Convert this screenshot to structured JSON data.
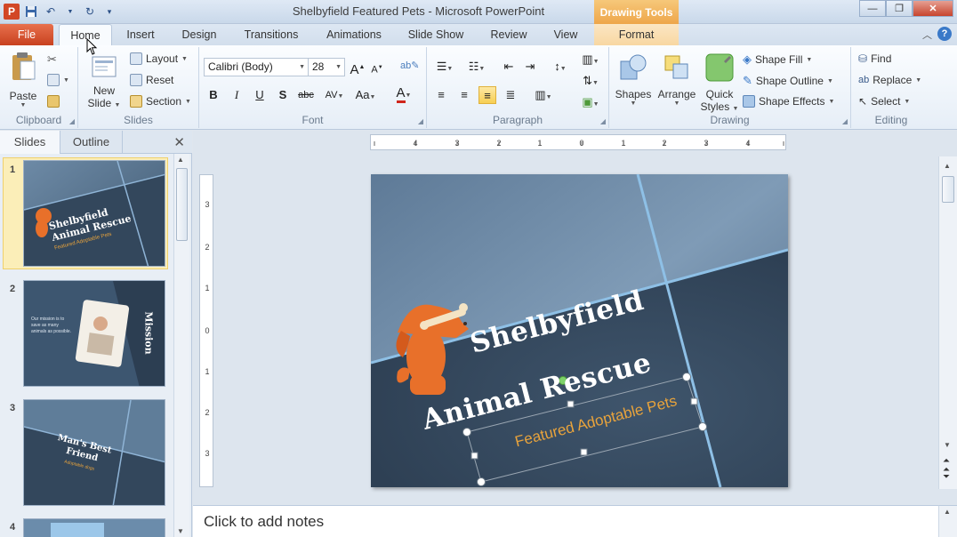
{
  "window": {
    "title": "Shelbyfield Featured Pets - Microsoft PowerPoint",
    "context_tab_group": "Drawing Tools",
    "minimize": "—",
    "restore": "❐",
    "close": "✕"
  },
  "tabs": [
    "File",
    "Home",
    "Insert",
    "Design",
    "Transitions",
    "Animations",
    "Slide Show",
    "Review",
    "View",
    "Format"
  ],
  "ribbon": {
    "clipboard": {
      "paste": "Paste",
      "label": "Clipboard"
    },
    "slides": {
      "new_slide_line1": "New",
      "new_slide_line2": "Slide",
      "layout": "Layout",
      "reset": "Reset",
      "section": "Section",
      "label": "Slides"
    },
    "font": {
      "font_name": "Calibri (Body)",
      "font_size": "28",
      "grow": "A",
      "shrink": "A",
      "bold": "B",
      "italic": "I",
      "underline": "U",
      "shadow": "S",
      "strike": "abc",
      "spacing": "AV",
      "case": "Aa",
      "color": "A",
      "label": "Font"
    },
    "paragraph": {
      "label": "Paragraph"
    },
    "drawing": {
      "shapes": "Shapes",
      "arrange": "Arrange",
      "quick_styles_line1": "Quick",
      "quick_styles_line2": "Styles",
      "shape_fill": "Shape Fill",
      "shape_outline": "Shape Outline",
      "shape_effects": "Shape Effects",
      "label": "Drawing"
    },
    "editing": {
      "find": "Find",
      "replace": "Replace",
      "select": "Select",
      "label": "Editing"
    }
  },
  "left_pane": {
    "tabs": [
      "Slides",
      "Outline"
    ],
    "slide_numbers": [
      "1",
      "2",
      "3",
      "4"
    ],
    "thumb1": {
      "line1": "Shelbyfield",
      "line2": "Animal Rescue",
      "sub": "Featured Adoptable Pets"
    },
    "thumb2": {
      "title": "Mission",
      "body": "Our mission is to save as many animals as possible."
    },
    "thumb3": {
      "line1": "Man's Best",
      "line2": "Friend",
      "sub": "Adoptable dogs"
    }
  },
  "slide": {
    "title_line1": "Shelbyfield",
    "title_line2": "Animal Rescue",
    "subtitle": "Featured Adoptable Pets"
  },
  "notes": {
    "placeholder": "Click to add notes"
  },
  "colors": {
    "accent_orange": "#e8702a",
    "slide_dark": "#34495d",
    "subtitle_gold": "#e8a33c"
  }
}
